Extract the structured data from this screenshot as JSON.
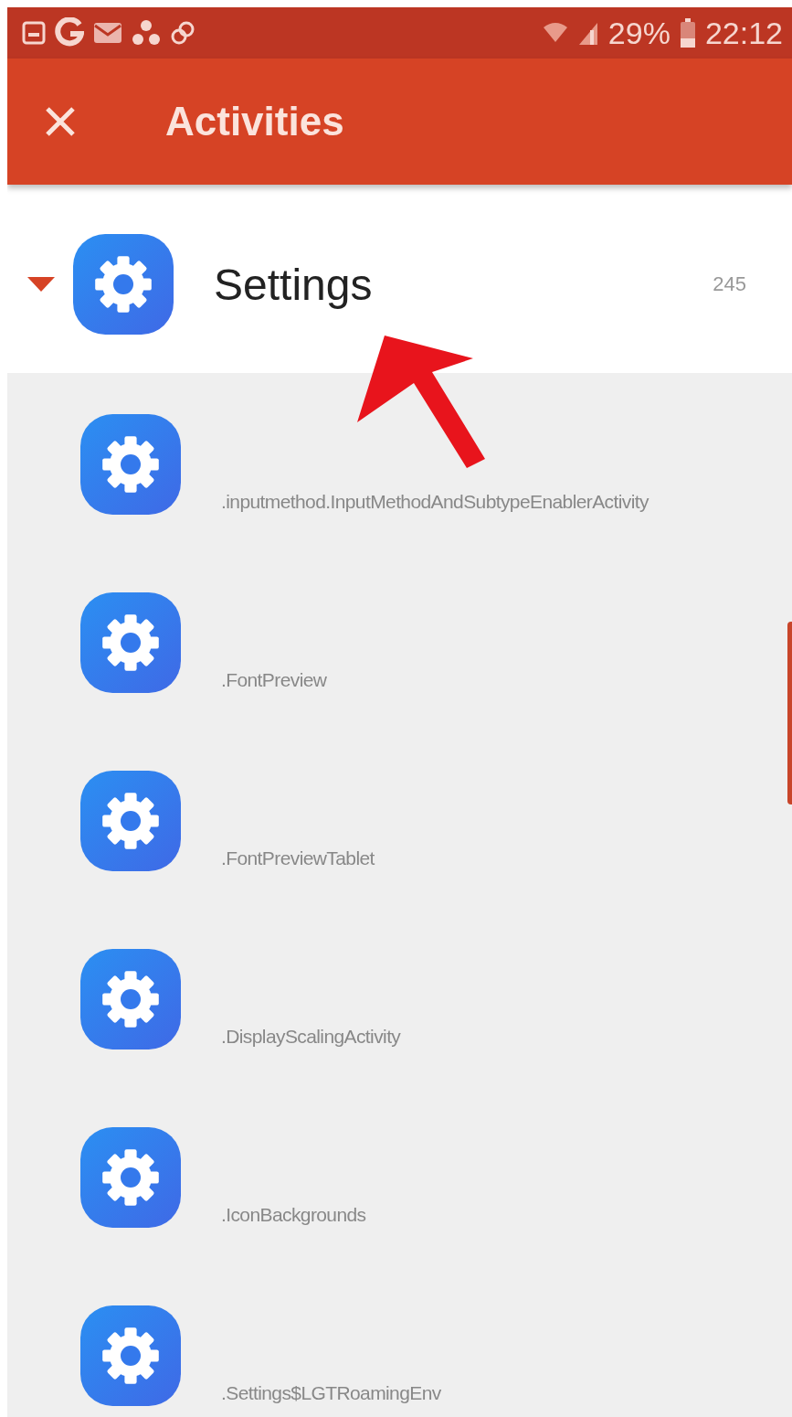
{
  "status_bar": {
    "battery": "29%",
    "time": "22:12"
  },
  "app_bar": {
    "title": "Activities"
  },
  "group": {
    "name": "Settings",
    "count": "245",
    "expanded": true,
    "activities": [
      {
        "name": ".inputmethod.InputMethodAndSubtypeEnablerActivity"
      },
      {
        "name": ".FontPreview"
      },
      {
        "name": ".FontPreviewTablet"
      },
      {
        "name": ".DisplayScalingActivity"
      },
      {
        "name": ".IconBackgrounds"
      },
      {
        "name": ".Settings$LGTRoamingEnv"
      }
    ]
  }
}
